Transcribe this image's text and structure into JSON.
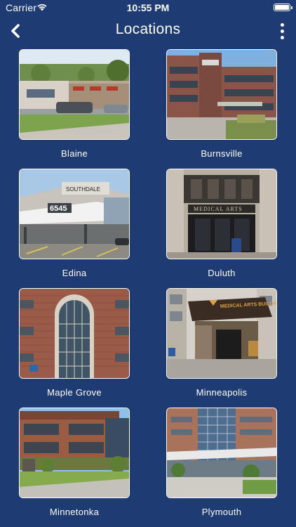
{
  "status_bar": {
    "carrier": "Carrier",
    "time": "10:55 PM"
  },
  "header": {
    "title": "Locations"
  },
  "locations": [
    {
      "label": "Blaine",
      "photo": "blaine-clinic-photo"
    },
    {
      "label": "Burnsville",
      "photo": "burnsville-clinic-photo"
    },
    {
      "label": "Edina",
      "photo": "edina-clinic-photo"
    },
    {
      "label": "Duluth",
      "photo": "duluth-clinic-photo"
    },
    {
      "label": "Maple Grove",
      "photo": "maple-grove-clinic-photo"
    },
    {
      "label": "Minneapolis",
      "photo": "minneapolis-clinic-photo"
    },
    {
      "label": "Minnetonka",
      "photo": "minnetonka-clinic-photo"
    },
    {
      "label": "Plymouth",
      "photo": "plymouth-clinic-photo"
    }
  ],
  "photo_text": {
    "edina_number": "6545",
    "edina_sign": "SOUTHDALE",
    "duluth_sign": "MEDICAL ARTS",
    "minneapolis_sign": "MEDICAL ARTS BUILDING"
  },
  "colors": {
    "background": "#1f3b73",
    "text": "#ffffff"
  }
}
